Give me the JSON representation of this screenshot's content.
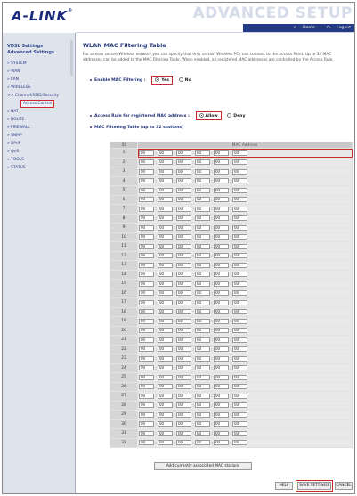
{
  "header": {
    "logo": "A-LINK",
    "banner": "ADVANCED SETUP",
    "home_link": "Home",
    "logout_link": "Logout"
  },
  "sidebar": {
    "heading1": "VDSL Settings",
    "heading2": "Advanced Settings",
    "items": [
      {
        "label": "SYSTEM"
      },
      {
        "label": "WAN"
      },
      {
        "label": "LAN"
      },
      {
        "label": "WIRELESS"
      },
      {
        "label": "Channel/SSID/Security"
      },
      {
        "label": "Access Control"
      },
      {
        "label": "NAT"
      },
      {
        "label": "ROUTE"
      },
      {
        "label": "FIREWALL"
      },
      {
        "label": "SNMP"
      },
      {
        "label": "UPnP"
      },
      {
        "label": "QoS"
      },
      {
        "label": "TOOLS"
      },
      {
        "label": "STATUS"
      }
    ]
  },
  "main": {
    "title": "WLAN MAC Filtering Table",
    "description": "For a more secure Wireless network you can specify that only certain Wireless PCs can connect to the Access Point. Up to 32 MAC addresses can be added to the MAC Filtering Table. When enabled, all registered MAC addresses are controlled by the Access Rule.",
    "enable_label": "Enable MAC Filtering :",
    "enable_yes": "Yes",
    "enable_no": "No",
    "rule_label": "Access Rule for registered MAC address :",
    "rule_allow": "Allow",
    "rule_deny": "Deny",
    "table_label": "MAC Filtering Table (up to 32 stations)",
    "col_id": "ID",
    "col_mac": "MAC Address",
    "row_ids": [
      "1",
      "2",
      "3",
      "4",
      "5",
      "6",
      "7",
      "8",
      "9",
      "10",
      "11",
      "12",
      "13",
      "14",
      "15",
      "16",
      "17",
      "18",
      "19",
      "20",
      "21",
      "22",
      "23",
      "24",
      "25",
      "26",
      "27",
      "28",
      "29",
      "30",
      "31",
      "32"
    ],
    "octet_value": "00",
    "add_button": "Add currently associated MAC stations",
    "help_button": "HELP",
    "save_button": "SAVE SETTINGS",
    "cancel_button": "CANCEL"
  },
  "colors": {
    "brand": "#1b2a7a",
    "highlight": "#cc2a2a",
    "sidebar_bg": "#dfe3ec"
  }
}
